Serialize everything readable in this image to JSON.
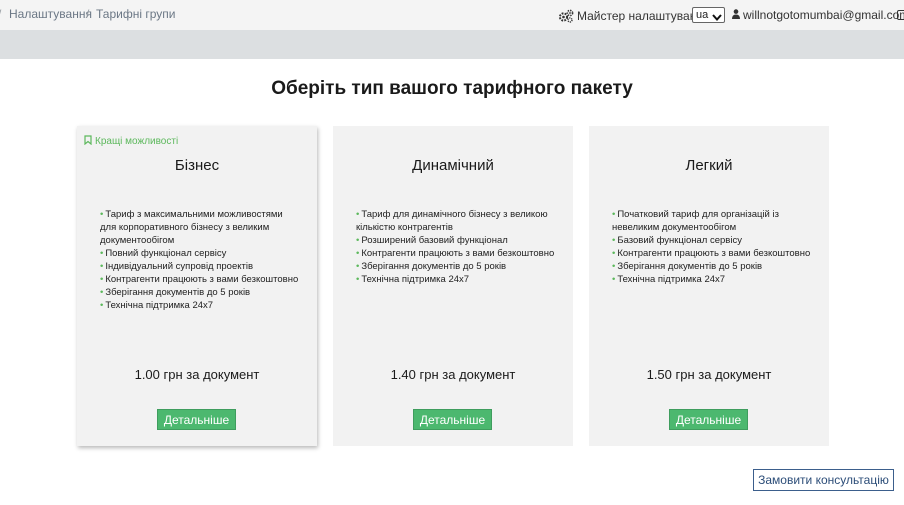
{
  "breadcrumb": {
    "leading_separator": "/",
    "items": [
      "Налаштування",
      "Тарифні групи"
    ],
    "separator": "/"
  },
  "header": {
    "wizard_label": "Майстер налаштувань",
    "wizard_icon": "gears-icon",
    "language": "ua",
    "user_email": "willnotgotomumbai@gmail.com",
    "user_icon": "user-icon",
    "logout_icon": "logout-icon"
  },
  "page": {
    "title": "Оберіть тип вашого тарифного пакету"
  },
  "plans": [
    {
      "badge": "Кращі можливості",
      "name": "Бізнес",
      "features": [
        "Тариф з максимальними можливостями для корпоративного бізнесу з великим документообігом",
        "Повний функціонал сервісу",
        "Індивідуальний супровід проектів",
        "Контрагенти працюють з вами безкоштовно",
        "Зберігання документів до 5 років",
        "Технічна підтримка 24х7"
      ],
      "price": "1.00 грн за документ",
      "button": "Детальніше"
    },
    {
      "name": "Динамічний",
      "features": [
        "Тариф для динамічного бізнесу з великою кількістю контрагентів",
        "Розширений базовий функціонал",
        "Контрагенти працюють з вами безкоштовно",
        "Зберігання документів до 5 років",
        "Технічна підтримка 24х7"
      ],
      "price": "1.40 грн за документ",
      "button": "Детальніше"
    },
    {
      "name": "Легкий",
      "features": [
        "Початковий тариф для організацій із невеликим документообігом",
        "Базовий функціонал сервісу",
        "Контрагенти працюють з вами безкоштовно",
        "Зберігання документів до 5 років",
        "Технічна підтримка 24х7"
      ],
      "price": "1.50 грн за документ",
      "button": "Детальніше"
    }
  ],
  "consult_button": "Замовити консультацію",
  "colors": {
    "accent_green": "#4cb86f",
    "bullet_green": "#5cb85c",
    "consult_border": "#3b5e8c"
  }
}
